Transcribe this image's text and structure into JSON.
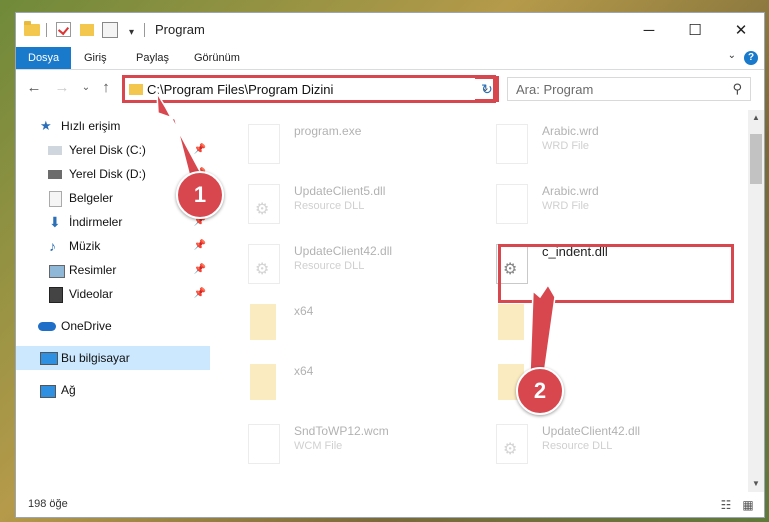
{
  "window": {
    "title": "Program"
  },
  "menu": {
    "file": "Dosya",
    "home": "Giriş",
    "share": "Paylaş",
    "view": "Görünüm"
  },
  "address": {
    "path": "C:\\Program Files\\Program Dizini"
  },
  "search": {
    "placeholder": "Ara: Program"
  },
  "sidebar": {
    "items": [
      {
        "label": "Hızlı erişim",
        "icon": "star-icon"
      },
      {
        "label": "Yerel Disk (C:)",
        "icon": "drive-icon"
      },
      {
        "label": "Yerel Disk (D:)",
        "icon": "drive-icon"
      },
      {
        "label": "Belgeler",
        "icon": "documents-icon"
      },
      {
        "label": "İndirmeler",
        "icon": "download-icon"
      },
      {
        "label": "Müzik",
        "icon": "music-icon"
      },
      {
        "label": "Resimler",
        "icon": "pictures-icon"
      },
      {
        "label": "Videolar",
        "icon": "video-icon"
      },
      {
        "label": "OneDrive",
        "icon": "cloud-icon"
      },
      {
        "label": "Bu bilgisayar",
        "icon": "computer-icon"
      },
      {
        "label": "Ağ",
        "icon": "network-icon"
      }
    ]
  },
  "files": [
    {
      "name": "program.exe",
      "type": ""
    },
    {
      "name": "Arabic.wrd",
      "type": "WRD File"
    },
    {
      "name": "UpdateClient5.dll",
      "type": "Resource DLL"
    },
    {
      "name": "Arabic.wrd",
      "type": "WRD File"
    },
    {
      "name": "UpdateClient42.dll",
      "type": "Resource DLL"
    },
    {
      "name": "c_indent.dll",
      "type": ""
    },
    {
      "name": "x64",
      "type": ""
    },
    {
      "name": "",
      "type": ""
    },
    {
      "name": "x64",
      "type": ""
    },
    {
      "name": "",
      "type": ""
    },
    {
      "name": "SndToWP12.wcm",
      "type": "WCM File"
    },
    {
      "name": "UpdateClient42.dll",
      "type": "Resource DLL"
    }
  ],
  "status": {
    "count": "198 öğe"
  },
  "markers": {
    "one": "1",
    "two": "2"
  }
}
